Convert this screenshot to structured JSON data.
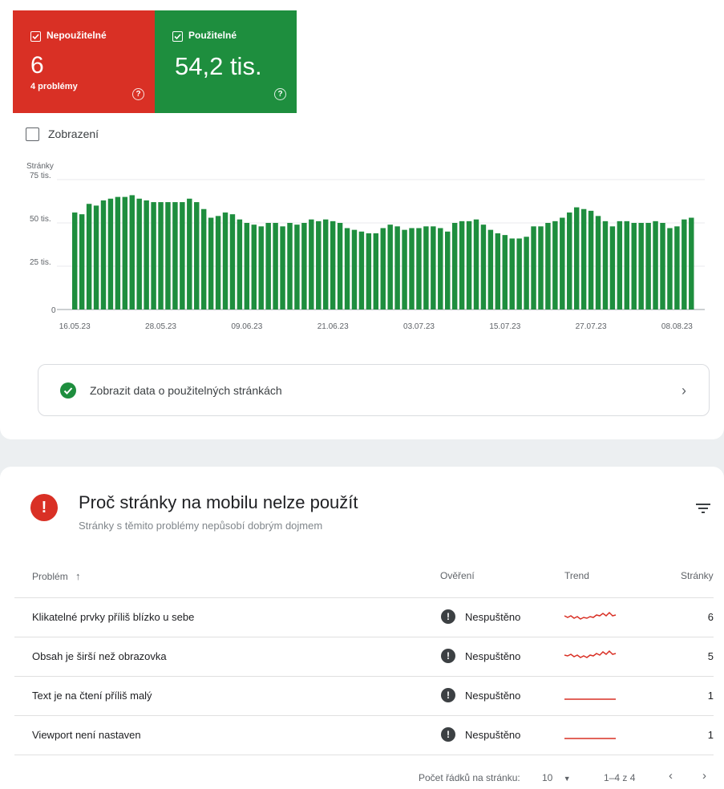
{
  "summary": {
    "unusable": {
      "label": "Nepoužitelné",
      "value": "6",
      "sub": "4 problémy",
      "color": "#d93025"
    },
    "usable": {
      "label": "Použitelné",
      "value": "54,2 tis.",
      "color": "#1e8e3e"
    }
  },
  "impressions_label": "Zobrazení",
  "chart_data": {
    "type": "bar",
    "ylabel": "Stránky",
    "y_ticks": [
      "75 tis.",
      "50 tis.",
      "25 tis.",
      "0"
    ],
    "ylim": [
      0,
      75000
    ],
    "x_tick_labels": [
      "16.05.23",
      "28.05.23",
      "09.06.23",
      "21.06.23",
      "03.07.23",
      "15.07.23",
      "27.07.23",
      "08.08.23"
    ],
    "bar_color": "#1e8e3e",
    "values": [
      56000,
      55000,
      61000,
      60000,
      63000,
      64000,
      65000,
      65000,
      66000,
      64000,
      63000,
      62000,
      62000,
      62000,
      62000,
      62000,
      64000,
      62000,
      58000,
      53000,
      54000,
      56000,
      55000,
      52000,
      50000,
      49000,
      48000,
      50000,
      50000,
      48000,
      50000,
      49000,
      50000,
      52000,
      51000,
      52000,
      51000,
      50000,
      47000,
      46000,
      45000,
      44000,
      44000,
      47000,
      49000,
      48000,
      46000,
      47000,
      47000,
      48000,
      48000,
      47000,
      45000,
      50000,
      51000,
      51000,
      52000,
      49000,
      46000,
      44000,
      43000,
      41000,
      41000,
      42000,
      48000,
      48000,
      50000,
      51000,
      53000,
      56000,
      59000,
      58000,
      57000,
      54000,
      51000,
      48000,
      51000,
      51000,
      50000,
      50000,
      50000,
      51000,
      50000,
      47000,
      48000,
      52000,
      53000
    ]
  },
  "usable_link": {
    "label": "Zobrazit data o použitelných stránkách"
  },
  "issues": {
    "title": "Proč stránky na mobilu nelze použít",
    "subtitle": "Stránky s těmito problémy nepůsobí dobrým dojmem",
    "columns": {
      "problem": "Problém",
      "validation": "Ověření",
      "trend": "Trend",
      "pages": "Stránky"
    },
    "rows": [
      {
        "name": "Klikatelné prvky příliš blízko u sebe",
        "status": "Nespuštěno",
        "count": "6"
      },
      {
        "name": "Obsah je širší než obrazovka",
        "status": "Nespuštěno",
        "count": "5"
      },
      {
        "name": "Text je na čtení příliš malý",
        "status": "Nespuštěno",
        "count": "1"
      },
      {
        "name": "Viewport není nastaven",
        "status": "Nespuštěno",
        "count": "1"
      }
    ],
    "trend_color": "#d93025"
  },
  "pagination": {
    "rows_label": "Počet řádků na stránku:",
    "rows_value": "10",
    "range": "1–4 z 4"
  }
}
